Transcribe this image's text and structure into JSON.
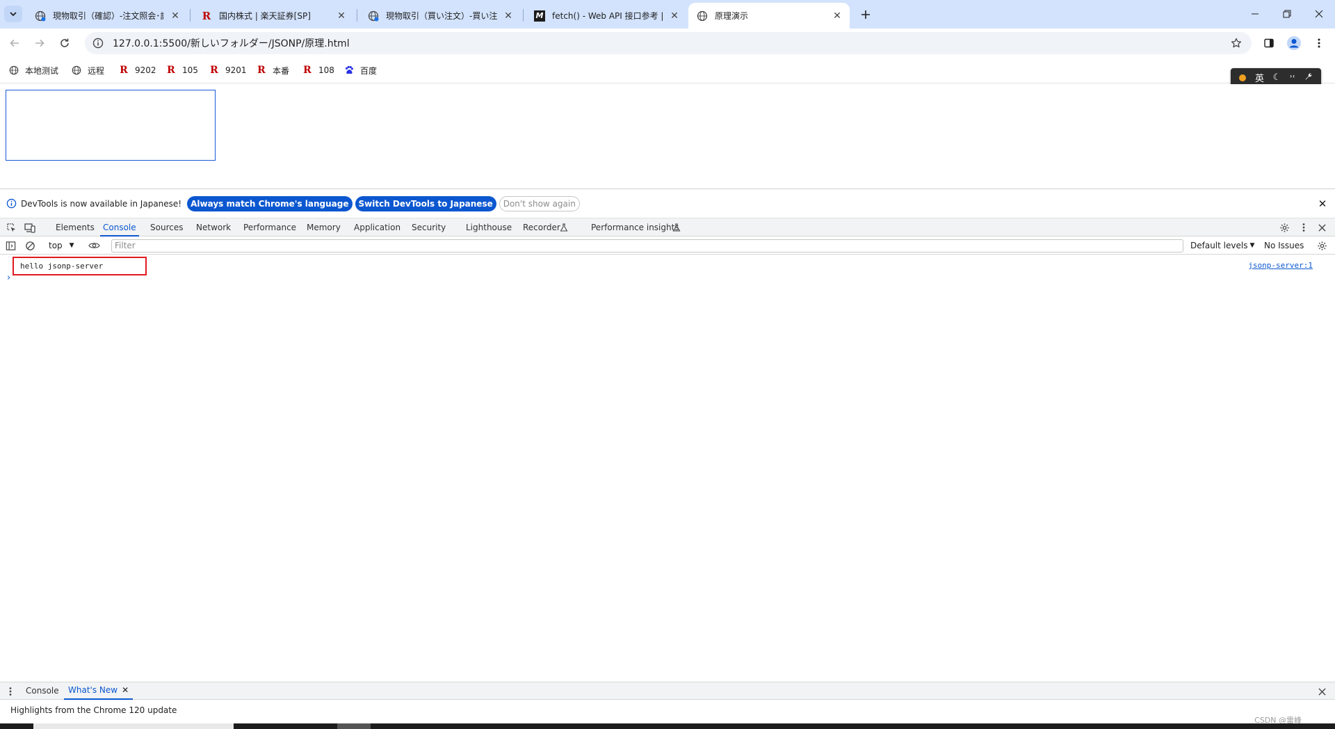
{
  "tabs": [
    {
      "title": "現物取引（確認）-注文照会･訂",
      "close": "✕"
    },
    {
      "title": "国内株式 | 楽天証券[SP]",
      "close": "✕"
    },
    {
      "title": "現物取引（買い注文）-買い注文",
      "close": "✕"
    },
    {
      "title": "fetch() - Web API 接口参考 | MD",
      "close": "✕"
    },
    {
      "title": "原理演示",
      "close": "✕"
    }
  ],
  "toolbar": {
    "url": "127.0.0.1:5500/新しいフォルダー/JSONP/原理.html"
  },
  "bookmarks": [
    {
      "label": "本地测试"
    },
    {
      "label": "远程"
    },
    {
      "label": "9202",
      "logo": "R"
    },
    {
      "label": "105",
      "logo": "R"
    },
    {
      "label": "9201",
      "logo": "R"
    },
    {
      "label": "本番",
      "logo": "R"
    },
    {
      "label": "108",
      "logo": "R"
    },
    {
      "label": "百度"
    }
  ],
  "ext_widget": {
    "lang": "英"
  },
  "devtools": {
    "infobar": {
      "message": "DevTools is now available in Japanese!",
      "btn_match": "Always match Chrome's language",
      "btn_switch": "Switch DevTools to Japanese",
      "btn_dismiss": "Don't show again"
    },
    "tabs": [
      "Elements",
      "Console",
      "Sources",
      "Network",
      "Performance",
      "Memory",
      "Application",
      "Security",
      "Lighthouse",
      "Recorder",
      "Performance insights"
    ],
    "console_toolbar": {
      "context": "top",
      "filter_placeholder": "Filter",
      "levels": "Default levels",
      "issues": "No Issues"
    },
    "console": {
      "message": "hello jsonp-server",
      "source": "jsonp-server:1",
      "prompt": "›"
    },
    "drawer": {
      "tabs": [
        "Console",
        "What's New"
      ],
      "highlight": "Highlights from the Chrome 120 update",
      "watermark": "CSDN @雷峰"
    }
  },
  "colors": {
    "tabstrip": "#d3e3fd",
    "accent": "#0b57d0",
    "highlight_border": "#e0191f",
    "rakuten_red": "#bf0000"
  }
}
